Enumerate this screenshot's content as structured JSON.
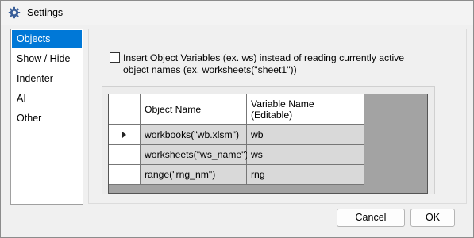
{
  "window": {
    "title": "Settings",
    "icon": "gear-icon"
  },
  "sidebar": {
    "items": [
      {
        "label": "Objects",
        "selected": true
      },
      {
        "label": "Show / Hide",
        "selected": false
      },
      {
        "label": "Indenter",
        "selected": false
      },
      {
        "label": "AI",
        "selected": false
      },
      {
        "label": "Other",
        "selected": false
      }
    ]
  },
  "objects": {
    "insert_variables_checkbox": {
      "checked": false,
      "line1": "Insert Object Variables (ex. ws) instead of reading currently active",
      "line2": "object names (ex. worksheets(\"sheet1\"))"
    },
    "grid": {
      "columns": [
        "Object Name",
        "Variable Name",
        "(Editable)"
      ],
      "rows": [
        {
          "object_name": "workbooks(\"wb.xlsm\")",
          "variable_name": "wb",
          "current": true
        },
        {
          "object_name": "worksheets(\"ws_name\")",
          "variable_name": "ws",
          "current": false
        },
        {
          "object_name": "range(\"rng_nm\")",
          "variable_name": "rng",
          "current": false
        }
      ]
    }
  },
  "buttons": {
    "cancel": "Cancel",
    "ok": "OK"
  }
}
